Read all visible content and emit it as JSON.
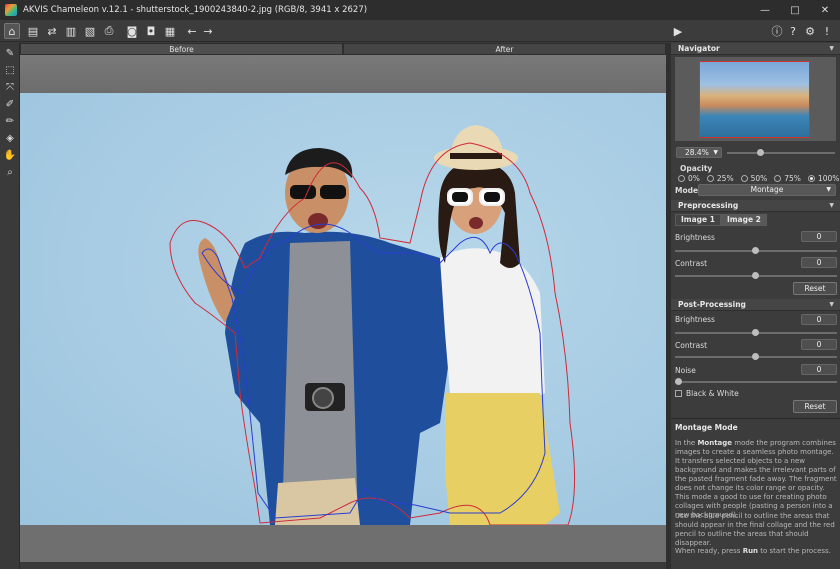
{
  "window": {
    "title": "AKVIS Chameleon v.12.1 - shutterstock_1900243840-2.jpg (RGB/8, 3941 x 2627)",
    "controls": [
      "—",
      "□",
      "✕"
    ]
  },
  "toolbar": {
    "icons": [
      "home-icon",
      "open-icon",
      "swap-icon",
      "import-icon",
      "export-icon",
      "print-icon",
      "fragment-icon",
      "background-icon",
      "layers-icon",
      "undo-icon",
      "redo-icon",
      "run-icon",
      "info-icon",
      "help-icon",
      "settings-icon",
      "notify-icon"
    ]
  },
  "tools": {
    "icons": [
      "eraser-icon",
      "selection-icon",
      "transform-icon",
      "blue-pencil-icon",
      "red-pencil-icon",
      "clean-icon",
      "hand-icon",
      "zoom-icon"
    ]
  },
  "canvas": {
    "tabs": [
      "Before",
      "After"
    ],
    "active_tab": "Before"
  },
  "navigator": {
    "title": "Navigator",
    "zoom": "28.4%"
  },
  "opacity": {
    "label": "Opacity",
    "options": [
      "0%",
      "25%",
      "50%",
      "75%",
      "100%"
    ],
    "selected": "100%"
  },
  "mode": {
    "label": "Mode",
    "value": "Montage"
  },
  "preprocessing": {
    "title": "Preprocessing",
    "tabs": [
      "Image 1",
      "Image 2"
    ],
    "active_tab": "Image 2",
    "brightness_label": "Brightness",
    "brightness": "0",
    "contrast_label": "Contrast",
    "contrast": "0",
    "reset_label": "Reset"
  },
  "postprocessing": {
    "title": "Post-Processing",
    "brightness_label": "Brightness",
    "brightness": "0",
    "contrast_label": "Contrast",
    "contrast": "0",
    "noise_label": "Noise",
    "noise": "0",
    "bw_label": "Black & White",
    "reset_label": "Reset"
  },
  "help": {
    "title": "Montage Mode",
    "p1_a": "In the ",
    "p1_b": "Montage",
    "p1_c": " mode the program combines images to create a seamless photo montage. It transfers selected objects to a new background and makes the irrelevant parts of the pasted fragment fade away. The fragment does not change its color range or opacity. This mode a good to use for creating photo collages with people (pasting a person into a new background).",
    "p2": "Use the blue pencil to outline the areas that should appear in the final collage and the red pencil to outline the areas that should disappear.",
    "p3_a": "When ready, press ",
    "p3_b": "Run",
    "p3_c": " to start the process."
  },
  "colors": {
    "accent_blue": "#2a3ccf",
    "accent_red": "#d02a3a",
    "panel_bg": "#3c3c3c"
  }
}
